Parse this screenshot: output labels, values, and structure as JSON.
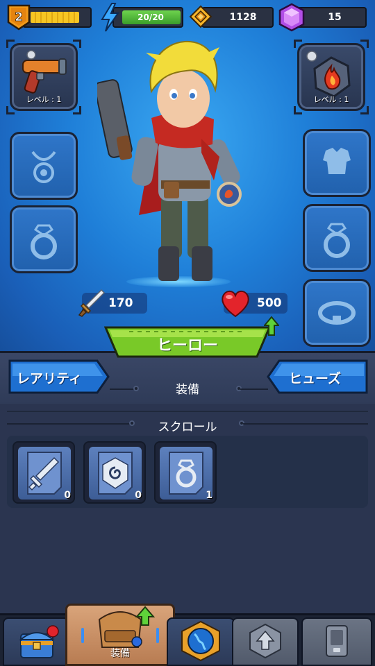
{
  "topbar": {
    "player_level": "2",
    "xp_progress": 0.85,
    "energy": "20/20",
    "energy_progress": 1.0,
    "gold": "1128",
    "gems": "15"
  },
  "slots": {
    "weapon": {
      "level_label": "レベル : 1",
      "icon": "raygun-icon"
    },
    "relic": {
      "level_label": "レベル : 1",
      "icon": "fire-stone-icon"
    },
    "necklace": {
      "icon": "necklace-icon"
    },
    "ring_left": {
      "icon": "ring-icon"
    },
    "armor": {
      "icon": "armor-icon"
    },
    "ring_right": {
      "icon": "ring-icon"
    },
    "belt": {
      "icon": "belt-icon"
    }
  },
  "stats": {
    "attack": "170",
    "health": "500"
  },
  "hero_button": {
    "label": "ヒーロー"
  },
  "panel": {
    "rarity_label": "レアリティ",
    "fuse_label": "ヒューズ",
    "equipment_title": "装備",
    "scroll_title": "スクロール"
  },
  "scrolls": [
    {
      "icon": "sword-icon",
      "count": "0"
    },
    {
      "icon": "stone-icon",
      "count": "0"
    },
    {
      "icon": "ring-icon",
      "count": "1"
    }
  ],
  "nav": {
    "equipment_label": "装備"
  },
  "colors": {
    "hero_bg": "#1f7fd8",
    "panel_bg": "#2b3550",
    "green_button": "#7ecf2f",
    "blue_button": "#1f73d4",
    "active_tab": "#c98c5e"
  }
}
